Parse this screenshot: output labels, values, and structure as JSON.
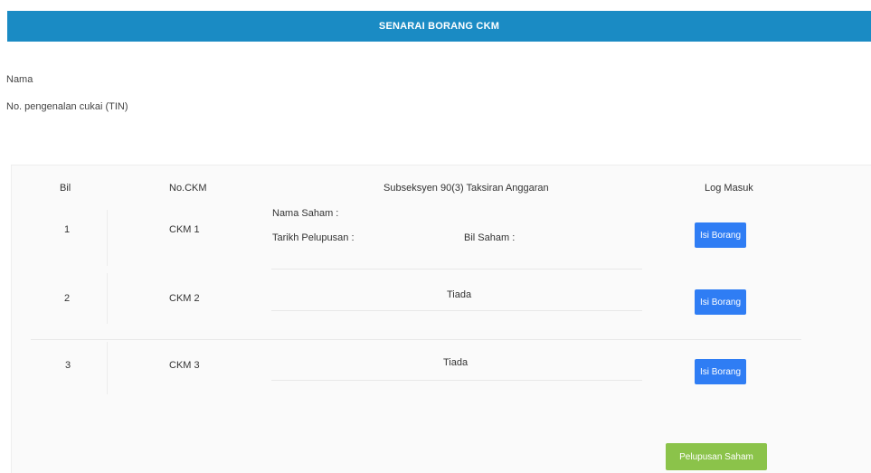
{
  "header": {
    "title": "SENARAI BORANG CKM"
  },
  "profile": {
    "name_label": "Nama",
    "tin_label": "No. pengenalan cukai (TIN)"
  },
  "table": {
    "headers": {
      "bil": "Bil",
      "no_ckm": "No.CKM",
      "subseksyen": "Subseksyen 90(3) Taksiran Anggaran",
      "log_masuk": "Log Masuk"
    },
    "rows": [
      {
        "bil": "1",
        "no_ckm": "CKM 1",
        "nama_saham": "Nama Saham :",
        "tarikh_pelupusan": "Tarikh Pelupusan :",
        "bil_saham": "Bil Saham :",
        "button": "Isi Borang"
      },
      {
        "bil": "2",
        "no_ckm": "CKM 2",
        "status": "Tiada",
        "button": "Isi Borang"
      },
      {
        "bil": "3",
        "no_ckm": "CKM 3",
        "status": "Tiada",
        "button": "Isi Borang"
      }
    ]
  },
  "footer": {
    "pelupusan_button": "Pelupusan Saham"
  },
  "colors": {
    "header_bg": "#1a8bc4",
    "primary_button": "#2f7df4",
    "success_button": "#8bc34a"
  }
}
